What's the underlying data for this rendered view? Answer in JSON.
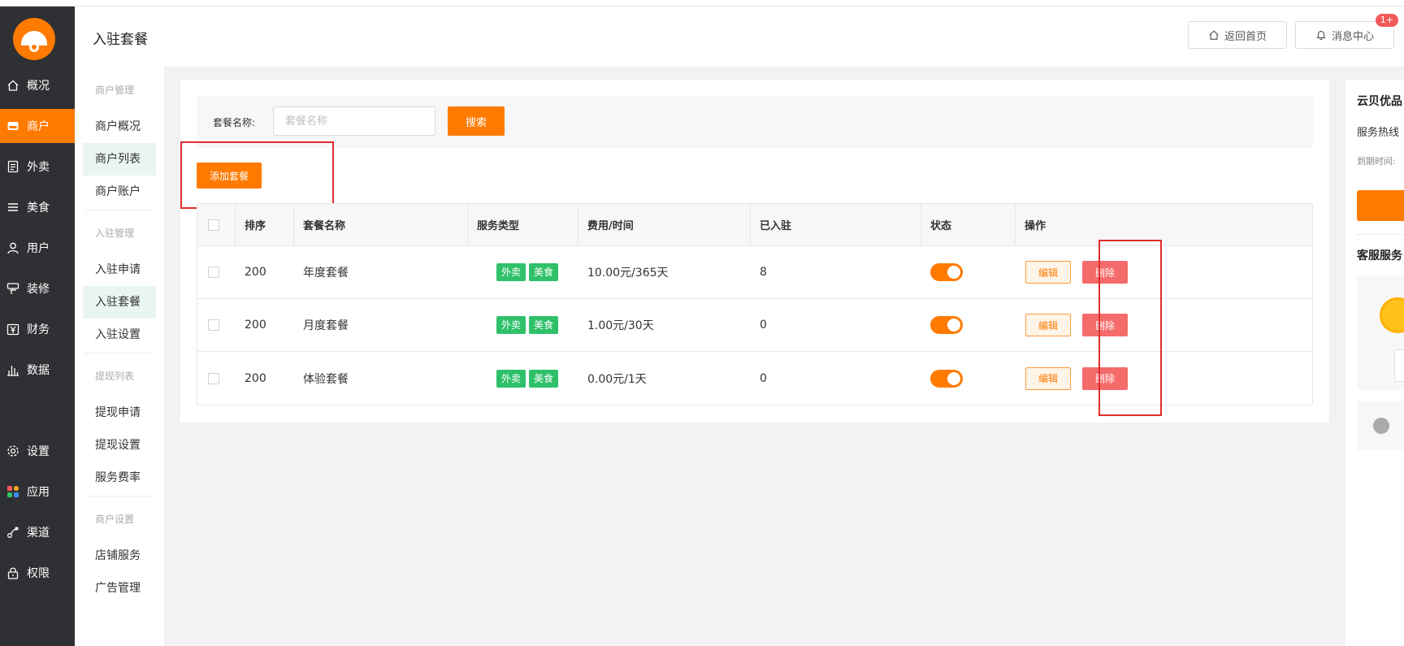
{
  "header": {
    "title": "入驻套餐",
    "home_label": "返回首页",
    "message_label": "消息中心",
    "message_badge": "1+"
  },
  "nav": {
    "items": [
      {
        "label": "概况",
        "icon": "home-icon"
      },
      {
        "label": "商户",
        "icon": "store-icon",
        "active": true
      },
      {
        "label": "外卖",
        "icon": "document-icon"
      },
      {
        "label": "美食",
        "icon": "menu-icon"
      },
      {
        "label": "用户",
        "icon": "user-icon"
      },
      {
        "label": "装修",
        "icon": "paint-icon"
      },
      {
        "label": "财务",
        "icon": "yuan-icon"
      },
      {
        "label": "数据",
        "icon": "bar-chart-icon"
      },
      {
        "label": "设置",
        "icon": "gear-icon"
      },
      {
        "label": "应用",
        "icon": "apps-icon"
      },
      {
        "label": "渠道",
        "icon": "channel-icon"
      },
      {
        "label": "权限",
        "icon": "lock-icon"
      }
    ]
  },
  "subnav": {
    "groups": [
      {
        "title": "商户管理",
        "items": [
          "商户概况",
          "商户列表",
          "商户账户"
        ]
      },
      {
        "title": "入驻管理",
        "items": [
          "入驻申请",
          "入驻套餐",
          "入驻设置"
        ]
      },
      {
        "title": "提现列表",
        "items": [
          "提现申请",
          "提现设置",
          "服务费率"
        ]
      },
      {
        "title": "商户设置",
        "items": [
          "店铺服务",
          "广告管理"
        ]
      }
    ]
  },
  "search": {
    "label": "套餐名称:",
    "placeholder": "套餐名称",
    "button": "搜索"
  },
  "add_button": "添加套餐",
  "table": {
    "columns": [
      "排序",
      "套餐名称",
      "服务类型",
      "费用/时间",
      "已入驻",
      "状态",
      "操作"
    ],
    "rows": [
      {
        "sort": "200",
        "name": "年度套餐",
        "tags": [
          "外卖",
          "美食"
        ],
        "fee": "10.00元/365天",
        "joined": "8",
        "enabled": true
      },
      {
        "sort": "200",
        "name": "月度套餐",
        "tags": [
          "外卖",
          "美食"
        ],
        "fee": "1.00元/30天",
        "joined": "0",
        "enabled": true
      },
      {
        "sort": "200",
        "name": "体验套餐",
        "tags": [
          "外卖",
          "美食"
        ],
        "fee": "0.00元/1天",
        "joined": "0",
        "enabled": true
      }
    ],
    "edit_label": "编辑",
    "delete_label": "删除"
  },
  "right_panel": {
    "title": "云贝优品",
    "hotline": "服务热线",
    "expire": "到期时间:",
    "service_title": "客服服务"
  },
  "colors": {
    "accent": "#ff7a00",
    "nav_bg": "#2f3033",
    "tag_green": "#2fc16a",
    "delete_red": "#f46b6b",
    "highlight_box": "#e02d2d"
  }
}
